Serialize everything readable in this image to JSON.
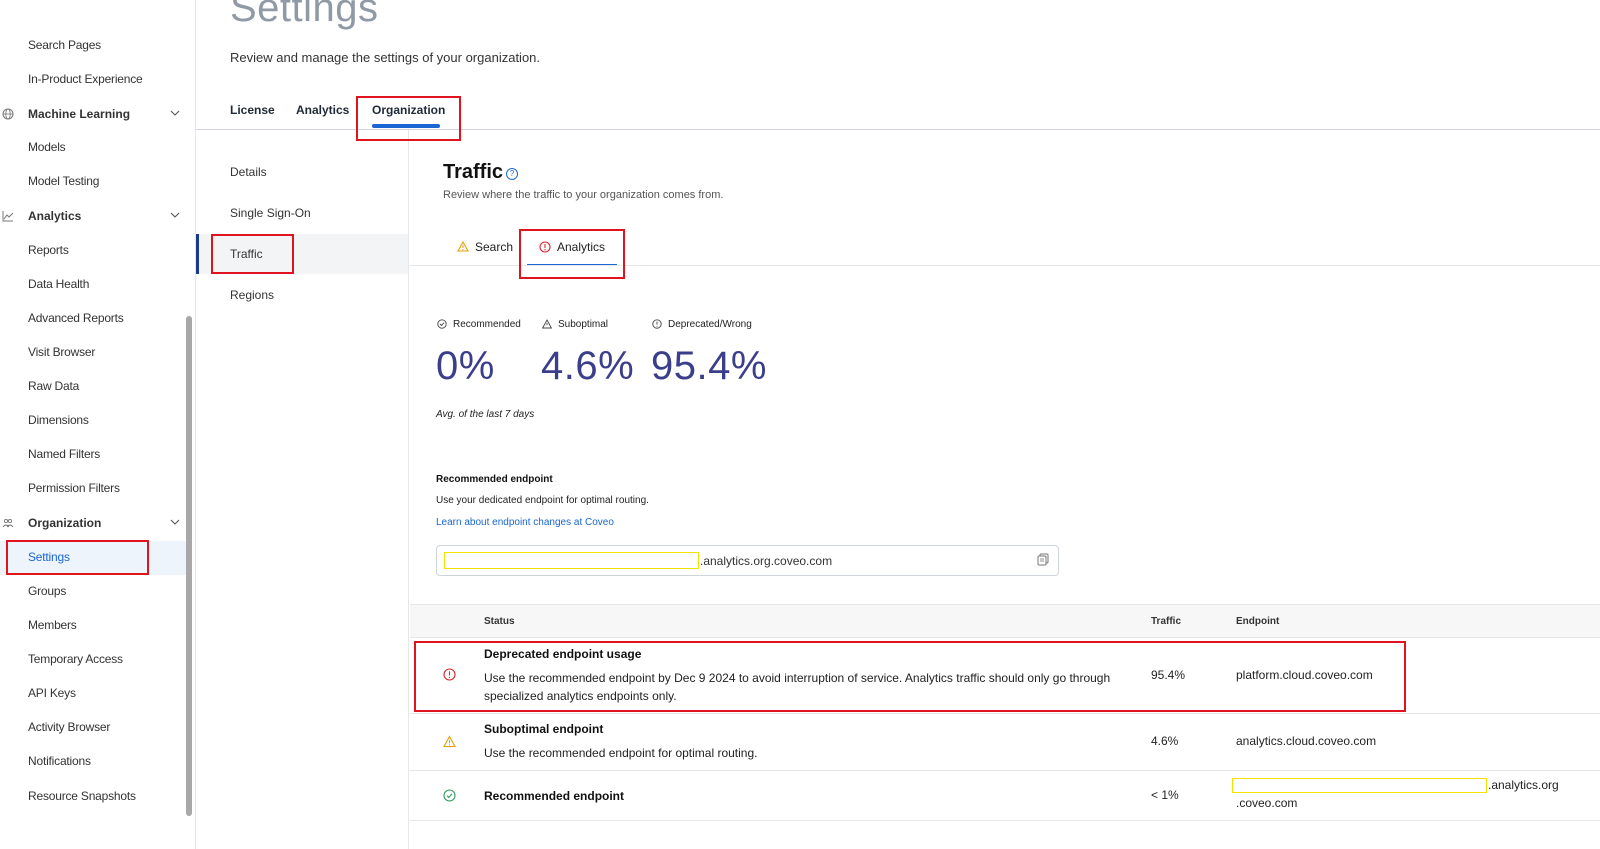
{
  "sidebar": {
    "items": [
      {
        "label": "Search Pages"
      },
      {
        "label": "In-Product Experience"
      }
    ],
    "groups": [
      {
        "label": "Machine Learning",
        "icon": "globe-icon"
      },
      {
        "label": "Analytics",
        "icon": "chart-line-icon"
      },
      {
        "label": "Organization",
        "icon": "organization-icon"
      }
    ],
    "ml_items": [
      "Models",
      "Model Testing"
    ],
    "analytics_items": [
      "Reports",
      "Data Health",
      "Advanced Reports",
      "Visit Browser",
      "Raw Data",
      "Dimensions",
      "Named Filters",
      "Permission Filters"
    ],
    "org_items": [
      "Settings",
      "Groups",
      "Members",
      "Temporary Access",
      "API Keys",
      "Activity Browser",
      "Notifications",
      "Resource Snapshots"
    ]
  },
  "header": {
    "title": "Settings",
    "subtitle": "Review and manage the settings of your organization.",
    "tabs": [
      "License",
      "Analytics",
      "Organization"
    ]
  },
  "subnav": {
    "items": [
      "Details",
      "Single Sign-On",
      "Traffic",
      "Regions"
    ]
  },
  "traffic": {
    "title": "Traffic",
    "description": "Review where the traffic to your organization comes from.",
    "tabs": [
      "Search",
      "Analytics"
    ],
    "legend": [
      "Recommended",
      "Suboptimal",
      "Deprecated/Wrong"
    ],
    "values": [
      "0%",
      "4.6%",
      "95.4%"
    ],
    "avg_note": "Avg. of the last 7 days",
    "recommended_heading": "Recommended endpoint",
    "recommended_desc": "Use your dedicated endpoint for optimal routing.",
    "learn_link": "Learn about endpoint changes at Coveo",
    "endpoint_suffix": ".analytics.org.coveo.com"
  },
  "table": {
    "headers": {
      "status": "Status",
      "traffic": "Traffic",
      "endpoint": "Endpoint"
    },
    "rows": [
      {
        "title": "Deprecated endpoint usage",
        "text_line1": "Use the recommended endpoint by Dec 9 2024 to avoid interruption of service. Analytics traffic should only go through",
        "text_line2": "specialized analytics endpoints only.",
        "traffic": "95.4%",
        "endpoint": "platform.cloud.coveo.com"
      },
      {
        "title": "Suboptimal endpoint",
        "text_line1": "Use the recommended endpoint for optimal routing.",
        "traffic": "4.6%",
        "endpoint": "analytics.cloud.coveo.com"
      },
      {
        "title": "Recommended endpoint",
        "traffic": "< 1%",
        "endpoint_suffix_1": ".analytics.org",
        "endpoint_suffix_2": ".coveo.com"
      }
    ]
  },
  "colors": {
    "accent": "#1a66d2",
    "highlight_red": "#e0141e",
    "redaction_yellow": "#f2e200",
    "big_number": "#3b3e8a"
  }
}
